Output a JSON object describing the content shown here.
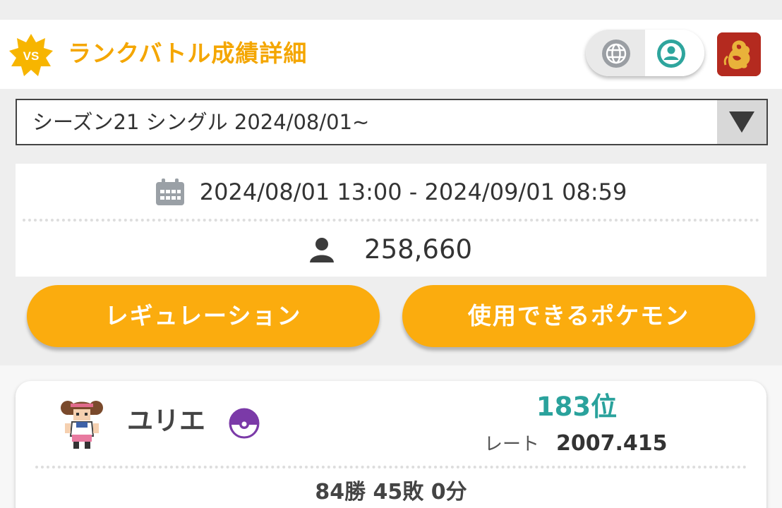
{
  "header": {
    "title": "ランクバトル成績詳細",
    "badge_text": "VS"
  },
  "season": {
    "selected": "シーズン21 シングル 2024/08/01~"
  },
  "info": {
    "period": "2024/08/01 13:00 - 2024/09/01 08:59",
    "players": "258,660"
  },
  "buttons": {
    "regulation": "レギュレーション",
    "usable_pokemon": "使用できるポケモン"
  },
  "player": {
    "name": "ユリエ",
    "rank": "183位",
    "rate_label": "レート",
    "rate_value": "2007.415",
    "record": "84勝 45敗 0分"
  },
  "colors": {
    "accent": "#f4a600",
    "button": "#fbac0e",
    "rank_teal": "#2aa29c",
    "ball_purple": "#7b3aa8"
  },
  "icons": [
    "vs-badge-icon",
    "globe-icon",
    "user-circle-icon",
    "trainer-avatar-icon",
    "dropdown-arrow-icon",
    "calendar-icon",
    "person-icon",
    "poke-ball-icon"
  ]
}
